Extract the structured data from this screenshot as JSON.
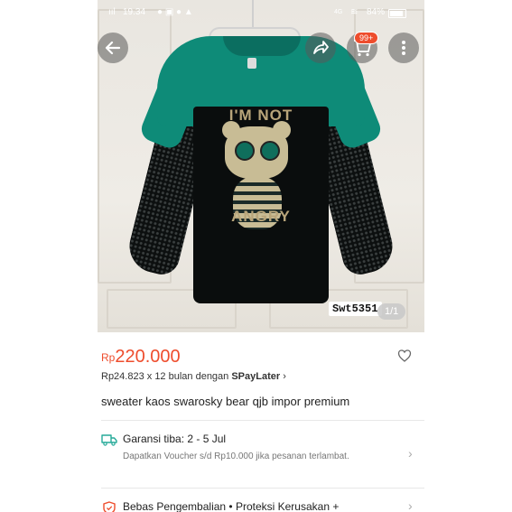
{
  "status_bar": {
    "time": "19.34",
    "network": "4G",
    "battery": "84%"
  },
  "overlay": {
    "back_icon": "arrow-left-icon",
    "share_icon": "share-icon",
    "cart_icon": "cart-icon",
    "cart_badge": "99+",
    "more_icon": "more-vertical-icon",
    "sku_label": "Swt5351",
    "image_pager": "1/1"
  },
  "product": {
    "currency": "Rp",
    "price": "220.000",
    "installment_prefix": "Rp24.823 x 12 bulan dengan ",
    "installment_brand": "SPayLater",
    "installment_chevron": "›",
    "title": "sweater kaos swarosky bear qjb impor premium",
    "print_top": "I'M NOT",
    "print_bottom": "ANGRY"
  },
  "shipping": {
    "icon": "truck-icon",
    "title": "Garansi tiba: 2 - 5 Jul",
    "subtitle": "Dapatkan Voucher s/d Rp10.000 jika pesanan terlambat."
  },
  "returns": {
    "icon": "shield-icon",
    "text": "Bebas Pengembalian  •  Proteksi Kerusakan +"
  },
  "colors": {
    "accent": "#ee4d2d",
    "teal": "#0e8b78"
  }
}
